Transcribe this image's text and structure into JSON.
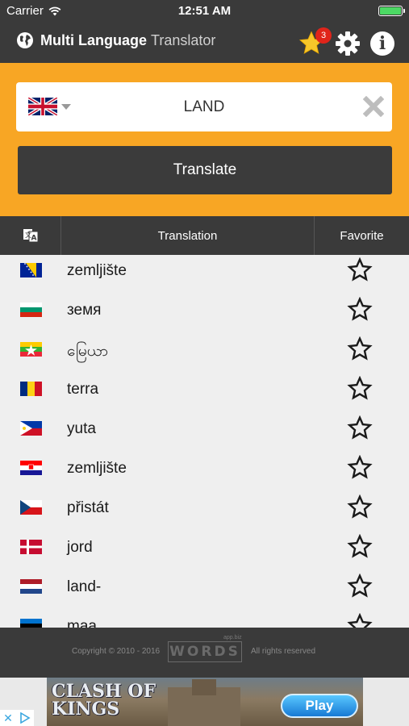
{
  "status_bar": {
    "carrier": "Carrier",
    "time": "12:51 AM",
    "battery_level": 1.0
  },
  "header": {
    "title_bold": "Multi Language",
    "title_light": "Translator",
    "favorites_count": "3",
    "icons": [
      "globe-icon",
      "star-icon",
      "gear-icon",
      "info-icon"
    ]
  },
  "search": {
    "source_language_flag": "uk-flag",
    "value": "LAND",
    "translate_label": "Translate"
  },
  "table": {
    "col_translation": "Translation",
    "col_favorite": "Favorite"
  },
  "results": [
    {
      "flag": "bosnia",
      "word": "zemljište"
    },
    {
      "flag": "bulgaria",
      "word": "земя"
    },
    {
      "flag": "myanmar",
      "word": "မြေယာ"
    },
    {
      "flag": "romania",
      "word": "terra"
    },
    {
      "flag": "philippines",
      "word": "yuta"
    },
    {
      "flag": "croatia",
      "word": "zemljište"
    },
    {
      "flag": "czech",
      "word": "přistát"
    },
    {
      "flag": "denmark",
      "word": "jord"
    },
    {
      "flag": "netherlands",
      "word": "land-"
    },
    {
      "flag": "estonia",
      "word": "maa"
    }
  ],
  "footer": {
    "copyright": "Copyright © 2010 - 2016",
    "logo": "WORDS",
    "logo_small": "app.biz",
    "rights": "All rights reserved"
  },
  "ad": {
    "title_line1": "CLASH OF",
    "title_line2": "KINGS",
    "play_label": "Play"
  },
  "colors": {
    "dark": "#3a3a3a",
    "orange": "#f8a624",
    "list_bg": "#efefef",
    "badge": "#e0241a"
  }
}
